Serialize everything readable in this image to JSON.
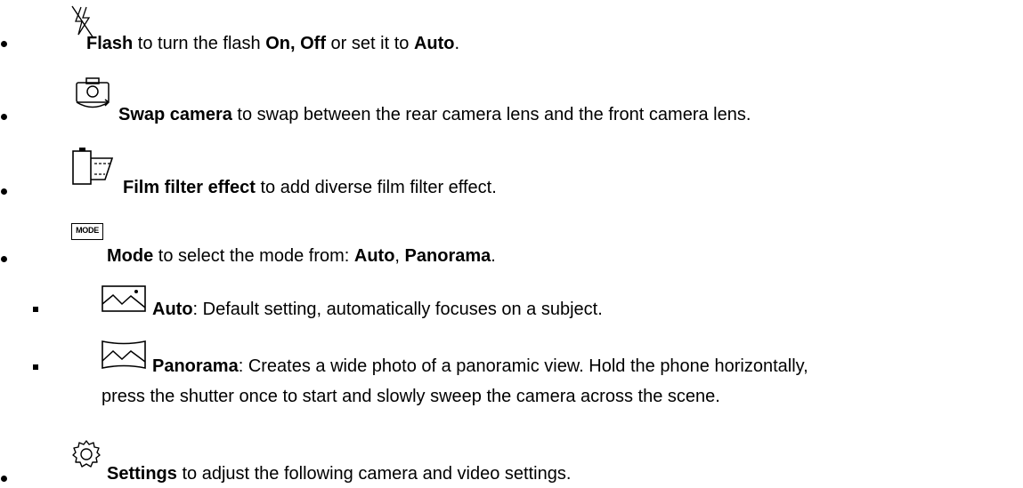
{
  "items": {
    "flash": {
      "icon": "flash-off-icon",
      "label": "Flash",
      "t1": " to turn the flash ",
      "b1": "On, Off",
      "t2": " or set it to ",
      "b2": "Auto",
      "t3": "."
    },
    "swap": {
      "icon": "swap-camera-icon",
      "label": "Swap camera",
      "t1": " to swap between the rear camera lens and the front camera lens."
    },
    "film": {
      "icon": "film-filter-icon",
      "label": "Film filter effect",
      "t1": " to add diverse film filter effect."
    },
    "mode": {
      "icon": "mode-icon",
      "icon_text": "MODE",
      "label": "Mode",
      "t1": " to select the mode from: ",
      "b1": "Auto",
      "t2": ", ",
      "b2": "Panorama",
      "t3": "."
    },
    "auto": {
      "icon": "landscape-icon",
      "label": "Auto",
      "t1": ": Default setting, automatically focuses on a subject."
    },
    "panorama": {
      "icon": "panorama-icon",
      "label": "Panorama",
      "t1": ": Creates a wide photo of a panoramic view. Hold the phone horizontally,",
      "line2": "press the shutter once to start and slowly sweep the camera across the scene."
    },
    "settings": {
      "icon": "settings-gear-icon",
      "label": "Settings",
      "t1": " to adjust the following camera and video settings."
    }
  }
}
